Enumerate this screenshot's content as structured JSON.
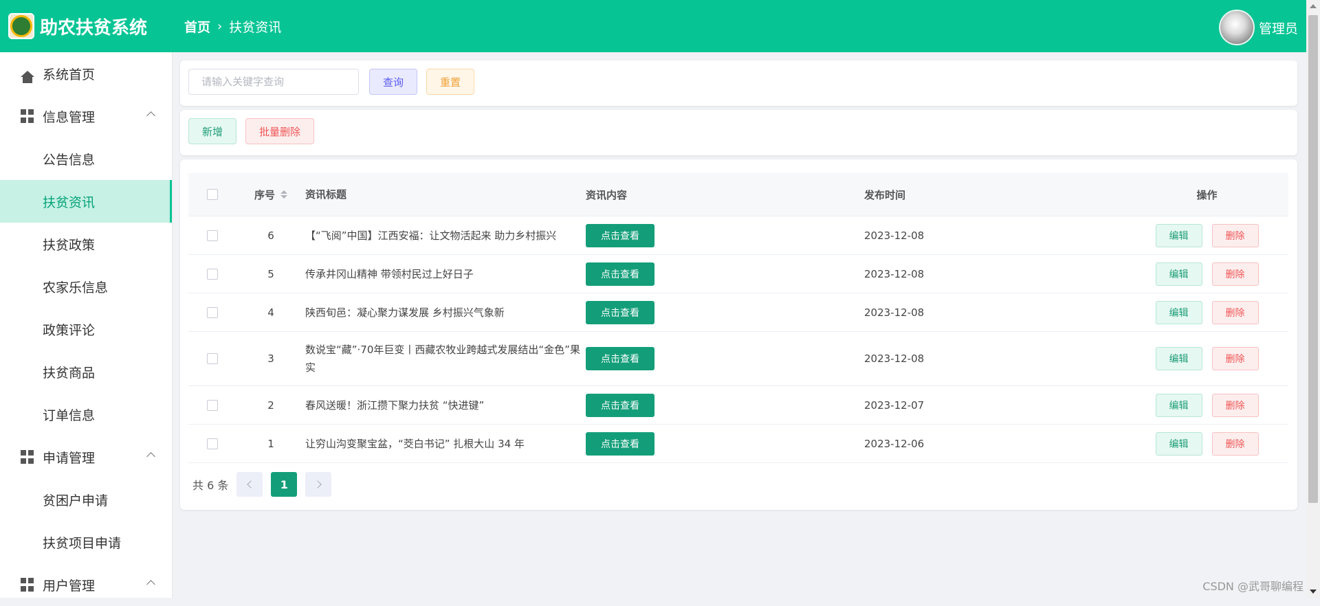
{
  "header": {
    "app_title": "助农扶贫系统",
    "breadcrumb": {
      "home": "首页",
      "separator": "›",
      "current": "扶贫资讯"
    },
    "user_name": "管理员",
    "accent_color": "#07c494"
  },
  "sidebar": {
    "items": [
      {
        "label": "系统首页",
        "level": "top",
        "icon": "home-icon"
      },
      {
        "label": "信息管理",
        "level": "top",
        "icon": "grid-icon",
        "expanded": true
      },
      {
        "label": "公告信息",
        "level": "sub"
      },
      {
        "label": "扶贫资讯",
        "level": "sub",
        "active": true
      },
      {
        "label": "扶贫政策",
        "level": "sub"
      },
      {
        "label": "农家乐信息",
        "level": "sub"
      },
      {
        "label": "政策评论",
        "level": "sub"
      },
      {
        "label": "扶贫商品",
        "level": "sub"
      },
      {
        "label": "订单信息",
        "level": "sub"
      },
      {
        "label": "申请管理",
        "level": "top",
        "icon": "grid-icon",
        "expanded": true
      },
      {
        "label": "贫困户申请",
        "level": "sub"
      },
      {
        "label": "扶贫项目申请",
        "level": "sub"
      },
      {
        "label": "用户管理",
        "level": "top",
        "icon": "grid-icon",
        "expanded": true
      }
    ]
  },
  "search": {
    "placeholder": "请输入关键字查询",
    "query_label": "查询",
    "reset_label": "重置"
  },
  "actions": {
    "add_label": "新增",
    "batch_delete_label": "批量删除"
  },
  "table": {
    "columns": {
      "no": "序号",
      "title": "资讯标题",
      "content": "资讯内容",
      "time": "发布时间",
      "op": "操作"
    },
    "view_label": "点击查看",
    "edit_label": "编辑",
    "delete_label": "删除",
    "rows": [
      {
        "no": "6",
        "title": "【“飞阅”中国】江西安福：让文物活起来 助力乡村振兴",
        "time": "2023-12-08"
      },
      {
        "no": "5",
        "title": "传承井冈山精神 带领村民过上好日子",
        "time": "2023-12-08"
      },
      {
        "no": "4",
        "title": "陕西旬邑：凝心聚力谋发展 乡村振兴气象新",
        "time": "2023-12-08"
      },
      {
        "no": "3",
        "title": "数说宝“藏”·70年巨变丨西藏农牧业跨越式发展结出“金色”果实",
        "time": "2023-12-08"
      },
      {
        "no": "2",
        "title": "春风送暖！浙江攒下聚力扶贫 “快进键”",
        "time": "2023-12-07"
      },
      {
        "no": "1",
        "title": "让穷山沟变聚宝盆，“茭白书记” 扎根大山 34 年",
        "time": "2023-12-06"
      }
    ]
  },
  "pagination": {
    "total_text": "共 6 条",
    "current_page": "1"
  },
  "watermark": "CSDN @武哥聊编程"
}
